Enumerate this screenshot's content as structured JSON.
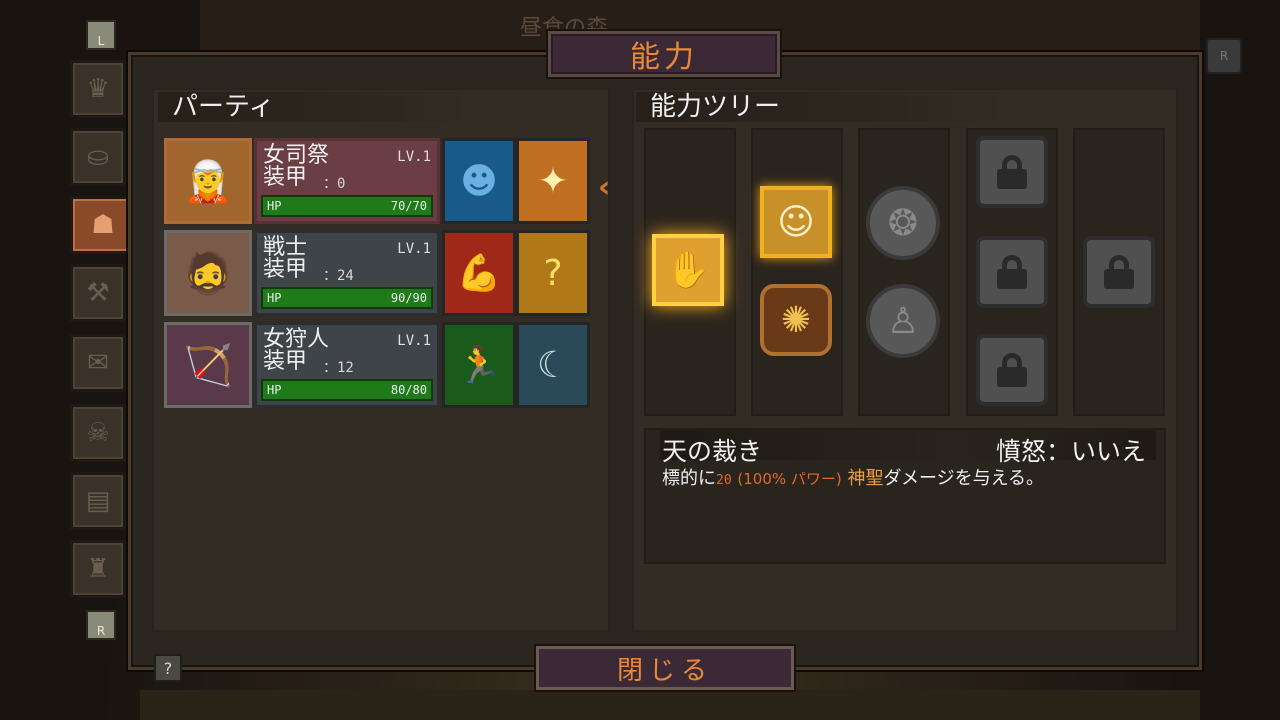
{
  "window": {
    "title": "能力",
    "bg_title": "昼食の森"
  },
  "side_keys": {
    "top": "L",
    "bottom": "R",
    "right": "R"
  },
  "tabs": [
    {
      "icon": "crown-icon",
      "glyph": "♛"
    },
    {
      "icon": "bag-icon",
      "glyph": "⚒"
    },
    {
      "icon": "hood-icon",
      "glyph": "☗",
      "active": true
    },
    {
      "icon": "anvil-icon",
      "glyph": "⚒"
    },
    {
      "icon": "scroll-icon",
      "glyph": "✉"
    },
    {
      "icon": "helmet-icon",
      "glyph": "☠"
    },
    {
      "icon": "book-icon",
      "glyph": "▤"
    },
    {
      "icon": "trophy-icon",
      "glyph": "♜"
    }
  ],
  "party": {
    "title": "パーティ",
    "members": [
      {
        "name": "女司祭",
        "level": "LV.1",
        "armor_label": "装甲",
        "armor": "：0",
        "hp_label": "HP",
        "hp": "70/70",
        "portrait": "priestess-portrait",
        "skill1": "shadow-head-icon",
        "skill2": "holy-priestess-icon"
      },
      {
        "name": "戦士",
        "level": "LV.1",
        "armor_label": "装甲",
        "armor": "：24",
        "hp_label": "HP",
        "hp": "90/90",
        "portrait": "warrior-portrait",
        "skill1": "flex-arm-icon",
        "skill2": "question-sword-icon"
      },
      {
        "name": "女狩人",
        "level": "LV.1",
        "armor_label": "装甲",
        "armor": "：12",
        "hp_label": "HP",
        "hp": "80/80",
        "portrait": "huntress-portrait",
        "skill1": "running-man-icon",
        "skill2": "moon-hunter-icon"
      }
    ]
  },
  "tree": {
    "title": "能力ツリー"
  },
  "description": {
    "name": "天の裁き",
    "rage_label": "憤怒：",
    "rage_value": "いいえ",
    "text_prefix": "標的に",
    "damage": "20",
    "power": "(100% パワー)",
    "holy": "神聖",
    "text_suffix": "ダメージを与える。"
  },
  "buttons": {
    "close": "閉じる",
    "help": "?"
  }
}
